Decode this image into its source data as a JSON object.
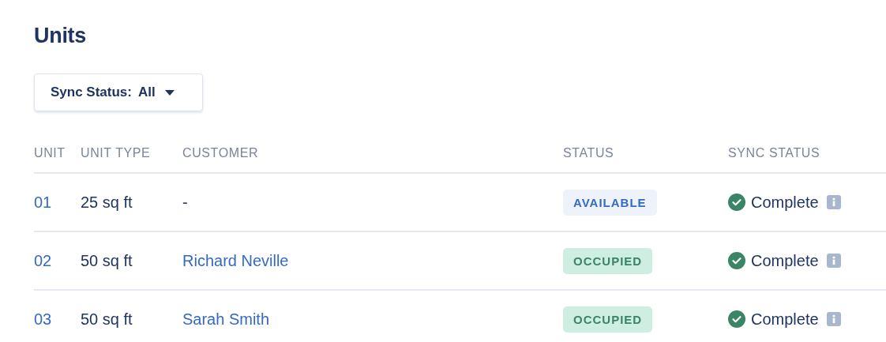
{
  "title": "Units",
  "filter": {
    "label": "Sync Status:",
    "value": "All"
  },
  "columns": [
    "UNIT",
    "UNIT TYPE",
    "CUSTOMER",
    "STATUS",
    "SYNC STATUS"
  ],
  "rows": [
    {
      "unit": "01",
      "unit_type": "25 sq ft",
      "customer": {
        "text": "-",
        "kind": "plain"
      },
      "status": {
        "text": "AVAILABLE",
        "kind": "available"
      },
      "sync": {
        "text": "Complete",
        "kind": "complete"
      }
    },
    {
      "unit": "02",
      "unit_type": "50 sq ft",
      "customer": {
        "text": "Richard Neville",
        "kind": "link"
      },
      "status": {
        "text": "OCCUPIED",
        "kind": "occupied"
      },
      "sync": {
        "text": "Complete",
        "kind": "complete"
      }
    },
    {
      "unit": "03",
      "unit_type": "50 sq ft",
      "customer": {
        "text": "Sarah Smith",
        "kind": "link"
      },
      "status": {
        "text": "OCCUPIED",
        "kind": "occupied"
      },
      "sync": {
        "text": "Complete",
        "kind": "complete"
      }
    }
  ]
}
